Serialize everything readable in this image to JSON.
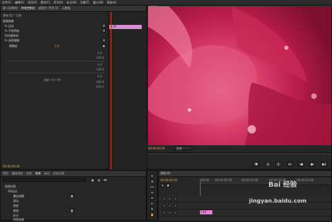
{
  "menu": [
    "文件(F)",
    "编辑(E)",
    "项目(P)",
    "素材(C)",
    "序列(S)",
    "标记(M)",
    "字幕(T)",
    "窗口(W)",
    "帮助(H)"
  ],
  "top_left_tabs": [
    "源: (无素材)",
    "特效控制台",
    "调音台: 序列 01",
    "元数据"
  ],
  "fx": {
    "clip_title": "序列 01 * 1.tif",
    "clip_label": "1.tif",
    "video_effects": "视频效果",
    "motion": "fx 运动",
    "opacity": "fx 不透明度",
    "time_remap": "时间重映射",
    "blur": "fx 高斯模糊",
    "blur_amount": "模糊度",
    "blur_value_orange": "2.0",
    "val_1": "0.0",
    "val_2": "100.0",
    "val_3": "0.0",
    "val_4": "100.0",
    "val_5": "0.0",
    "speed": "速度: 0.0 / 秒",
    "val_6": "100.0",
    "val_7": "-100.0",
    "timecode": "00:00:00:00"
  },
  "program": {
    "title": "节目: 序列 01",
    "timecode": "00:00:00:00",
    "fit": "适合"
  },
  "project": {
    "tabs": [
      "项目",
      "媒体浏览",
      "信息",
      "效果",
      "标记",
      "历史记录"
    ],
    "active_tab": "效果",
    "items": [
      "视频切换",
      "3D运动",
      "叠加溶解",
      "滑动",
      "擦除",
      "缩放",
      "拆分",
      "特殊效果"
    ]
  },
  "timeline": {
    "title": "序列 01",
    "timecode": "00:00:00:00",
    "ruler": [
      "00:00",
      "00:00:05:00",
      "00:00:10:00",
      "00:00:15:00",
      "00:00:20:00"
    ],
    "clip_label": "1.tif"
  },
  "watermark": {
    "site": "jingyan.baidu.com",
    "brand": "Bai 经验"
  },
  "colors": {
    "accent": "#e8a24a",
    "playhead": "#cc4a2a",
    "clip": "#e17fd0"
  }
}
